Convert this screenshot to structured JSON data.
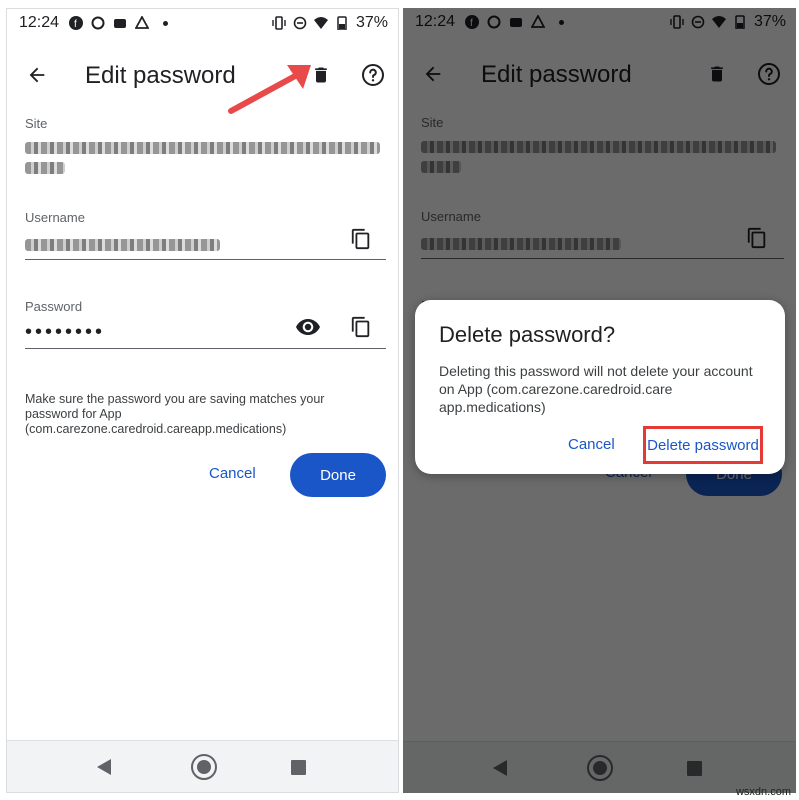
{
  "status": {
    "time": "12:24",
    "battery": "37%"
  },
  "header": {
    "title": "Edit password"
  },
  "fields": {
    "site_label": "Site",
    "username_label": "Username",
    "password_label": "Password",
    "password_mask": "••••••••"
  },
  "note": "Make sure the password you are saving matches your password for App (com.carezone.caredroid.careapp.medications)",
  "actions": {
    "cancel": "Cancel",
    "done": "Done"
  },
  "dialog": {
    "title": "Delete password?",
    "body": "Deleting this password will not delete your account on App (com.carezone.caredroid.care app.medications)",
    "cancel": "Cancel",
    "delete": "Delete password"
  },
  "colors": {
    "accent": "#1a56c8",
    "highlight": "#e53935",
    "arrow": "#e84a4a"
  },
  "icons": [
    "back-arrow-icon",
    "trash-icon",
    "help-icon",
    "copy-icon",
    "eye-icon",
    "nav-back-icon",
    "nav-home-icon",
    "nav-recent-icon"
  ],
  "watermark": "wsxdn.com"
}
